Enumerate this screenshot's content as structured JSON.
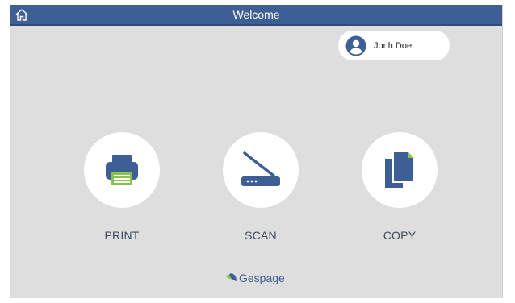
{
  "app": {
    "title": "Welcome"
  },
  "user": {
    "name": "Jonh Doe"
  },
  "actions": [
    {
      "label": "PRINT",
      "icon": "printer-icon"
    },
    {
      "label": "SCAN",
      "icon": "scanner-icon"
    },
    {
      "label": "COPY",
      "icon": "copy-icon"
    }
  ],
  "logo": {
    "text": "Gespage"
  },
  "colors": {
    "topbar": "#3d5f96",
    "background": "#dedede",
    "icon_blue": "#3d5f96",
    "accent_green": "#8bc34a",
    "label": "#3e4a5e"
  }
}
